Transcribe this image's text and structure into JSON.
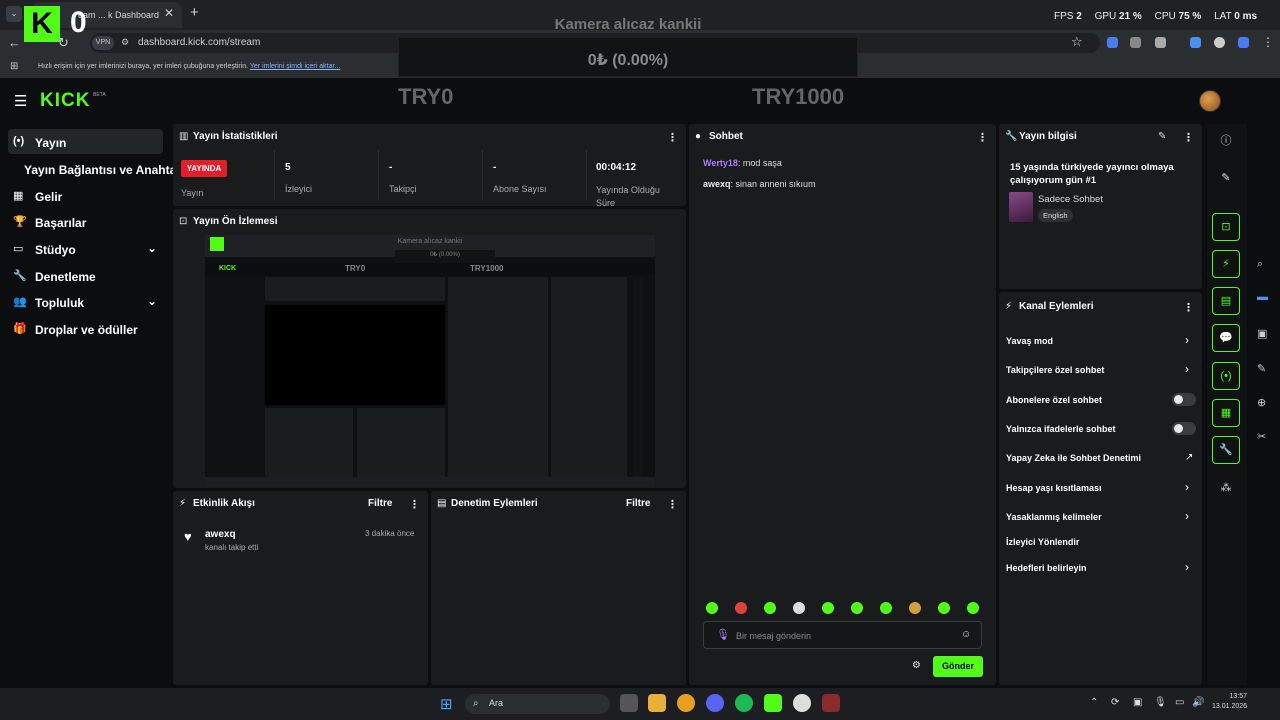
{
  "browser": {
    "tab_title": "eam ... k Dashboard",
    "url": "dashboard.kick.com/stream",
    "bookmarks_hint": "Hızlı erişim için yer imlerinizi buraya, yer imleri çubuğuna yerleştirin.",
    "bookmarks_link": "Yer imlerini şimdi içeri aktar..."
  },
  "overlay": {
    "title": "Kamera alıcaz kankii",
    "money": "0₺ (0.00%)",
    "counter": "0",
    "left_label": "TRY0",
    "right_label": "TRY1000",
    "stats": {
      "fps_label": "FPS",
      "fps": "2",
      "gpu_label": "GPU",
      "gpu": "21 %",
      "cpu_label": "CPU",
      "cpu": "75 %",
      "lat_label": "LAT",
      "lat": "0 ms"
    }
  },
  "header": {
    "logo": "KICK",
    "beta": "BETA"
  },
  "sidebar": {
    "items": [
      {
        "label": "Yayın",
        "icon": "broadcast-icon"
      },
      {
        "label": "Yayın Bağlantısı ve Anahtarı"
      },
      {
        "label": "Gelir",
        "icon": "chart-icon"
      },
      {
        "label": "Başarılar",
        "icon": "trophy-icon"
      },
      {
        "label": "Stüdyo",
        "icon": "studio-icon"
      },
      {
        "label": "Denetleme",
        "icon": "wrench-icon"
      },
      {
        "label": "Topluluk",
        "icon": "people-icon"
      },
      {
        "label": "Droplar ve ödüller",
        "icon": "gift-icon"
      }
    ]
  },
  "stats_panel": {
    "title": "Yayın İstatistikleri",
    "live_badge": "YAYINDA",
    "cells": [
      {
        "value": "",
        "label": "Yayın"
      },
      {
        "value": "5",
        "label": "İzleyici"
      },
      {
        "value": "-",
        "label": "Takipçi"
      },
      {
        "value": "-",
        "label": "Abone Sayısı"
      },
      {
        "value": "00:04:12",
        "label": "Yayında Olduğu Süre"
      }
    ]
  },
  "preview_panel": {
    "title": "Yayın Ön İzlemesi",
    "mini_title": "Kamera alıcaz kankii",
    "mini_money": "0₺ (0.00%)",
    "mini_try0": "TRY0",
    "mini_try1000": "TRY1000"
  },
  "activity_panel": {
    "title": "Etkinlik Akışı",
    "filter": "Filtre",
    "events": [
      {
        "user": "awexq",
        "action": "kanalı takip etti",
        "time": "3 dakika önce"
      }
    ]
  },
  "moderation_panel": {
    "title": "Denetim Eylemleri",
    "filter": "Filtre"
  },
  "chat": {
    "title": "Sohbet",
    "messages": [
      {
        "user": "Werty18",
        "text": ": mod saşa",
        "color": "#b07cff"
      },
      {
        "user": "awexq",
        "text": ": sinan anneni sıkıum",
        "color": "#e8e8e8"
      }
    ],
    "placeholder": "Bir mesaj gönderin",
    "send": "Gönder"
  },
  "stream_info": {
    "title": "Yayın bilgisi",
    "stream_title": "15 yaşında türkiyede yayıncı olmaya çalışıyorum gün #1",
    "category": "Sadece Sohbet",
    "language": "English"
  },
  "channel_actions": {
    "title": "Kanal Eylemleri",
    "items": [
      {
        "label": "Yavaş mod",
        "type": "chevron"
      },
      {
        "label": "Takipçilere özel sohbet",
        "type": "chevron"
      },
      {
        "label": "Abonelere özel sohbet",
        "type": "toggle"
      },
      {
        "label": "Yalnızca ifadelerle sohbet",
        "type": "toggle"
      },
      {
        "label": "Yapay Zeka ile Sohbet Denetimi",
        "type": "external"
      },
      {
        "label": "Hesap yaşı kısıtlaması",
        "type": "chevron"
      },
      {
        "label": "Yasaklanmış kelimeler",
        "type": "chevron"
      },
      {
        "label": "İzleyici Yönlendir",
        "type": "none"
      },
      {
        "label": "Hedefleri belirleyin",
        "type": "chevron"
      }
    ]
  },
  "taskbar": {
    "search": "Ara",
    "time": "13:57",
    "date": "13.01.2026"
  },
  "colors": {
    "accent": "#53fc18",
    "live": "#e21f2b",
    "panel": "#191b1c",
    "bg": "#0b0d0e"
  }
}
